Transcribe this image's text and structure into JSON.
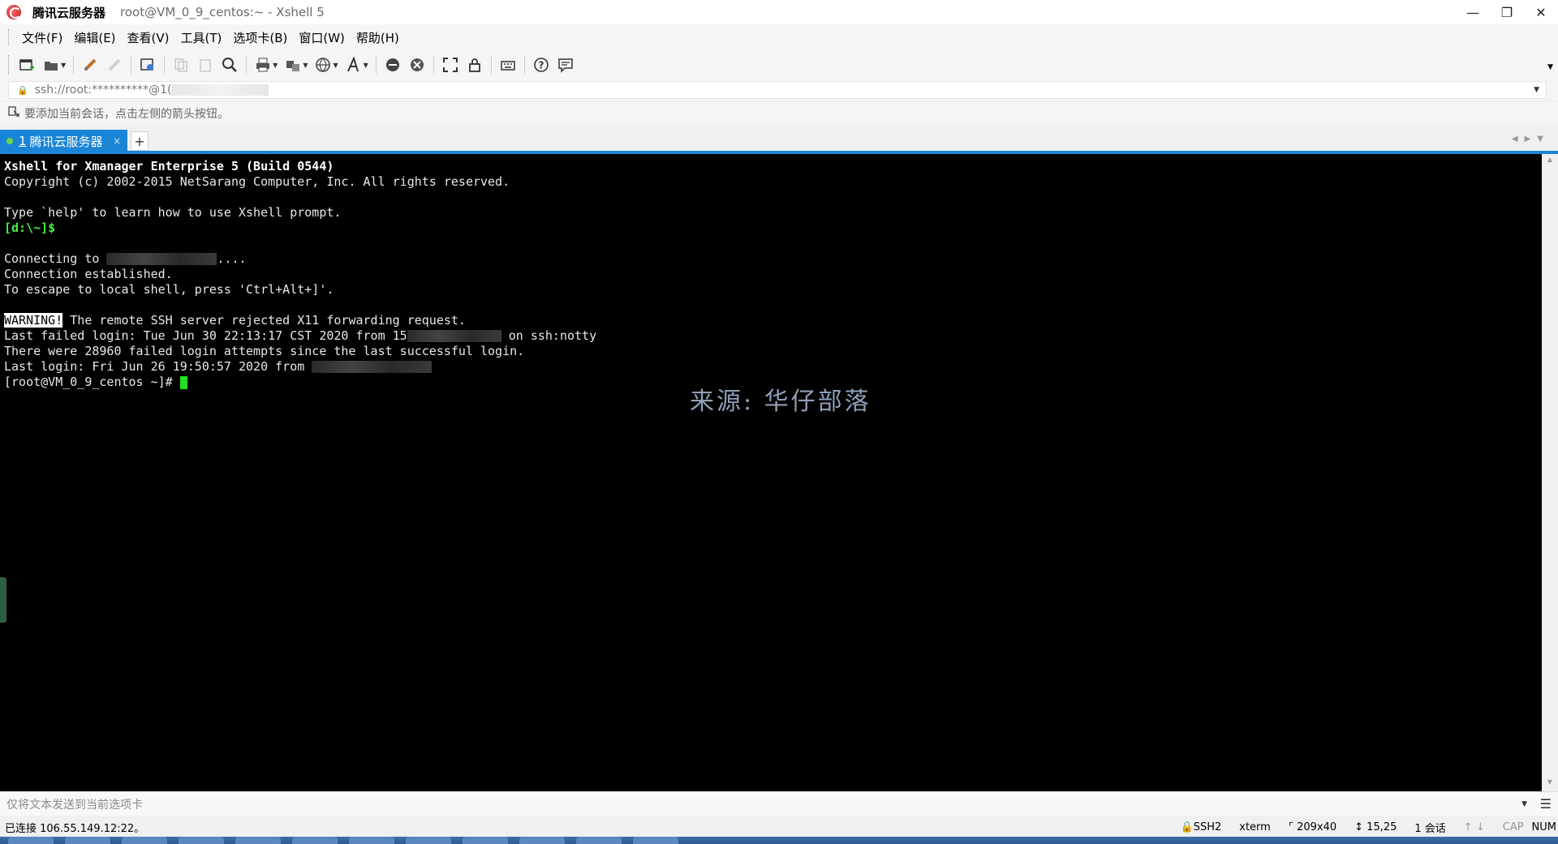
{
  "titlebar": {
    "session_name": "腾讯云服务器",
    "window_title": "root@VM_0_9_centos:~ - Xshell 5",
    "minimize": "—",
    "restore": "❐",
    "close": "✕"
  },
  "menu": {
    "items": [
      "文件(F)",
      "编辑(E)",
      "查看(V)",
      "工具(T)",
      "选项卡(B)",
      "窗口(W)",
      "帮助(H)"
    ]
  },
  "toolbar": {
    "icons": [
      "new-session-icon",
      "open-folder-icon",
      "connect-icon",
      "disconnect-icon",
      "session-properties-icon",
      "copy-icon",
      "paste-icon",
      "find-icon",
      "print-icon",
      "transfer-icon",
      "globe-icon",
      "font-icon",
      "xftp-icon",
      "xmanager-icon",
      "fullscreen-icon",
      "lock-icon",
      "keyboard-icon",
      "help-icon",
      "chat-icon"
    ]
  },
  "address": {
    "text": "ssh://root:**********@1("
  },
  "hint": {
    "text": "要添加当前会话，点击左侧的箭头按钮。"
  },
  "tabs": {
    "active": {
      "number": "1",
      "label": "腾讯云服务器",
      "close": "×"
    },
    "add": "+"
  },
  "terminal": {
    "line1": "Xshell for Xmanager Enterprise 5 (Build 0544)",
    "line2": "Copyright (c) 2002-2015 NetSarang Computer, Inc. All rights reserved.",
    "line4": "Type `help' to learn how to use Xshell prompt.",
    "line5": "[d:\\~]$",
    "line7_prefix": "Connecting to ",
    "line7_suffix": "....",
    "line8": "Connection established.",
    "line9": "To escape to local shell, press 'Ctrl+Alt+]'.",
    "warn_tag": "WARNING!",
    "warn_text": " The remote SSH server rejected X11 forwarding request.",
    "line12_prefix": "Last failed login: Tue Jun 30 22:13:17 CST 2020 from 15",
    "line12_suffix": " on ssh:notty",
    "line13": "There were 28960 failed login attempts since the last successful login.",
    "line14_prefix": "Last login: Fri Jun 26 19:50:57 2020 from ",
    "prompt": "[root@VM_0_9_centos ~]# ",
    "watermark": "来源: 华仔部落"
  },
  "compose": {
    "placeholder": "仅将文本发送到当前选项卡"
  },
  "status": {
    "connected": "已连接 106.55.149.12:22。",
    "protocol": "SSH2",
    "term": "xterm",
    "size": "209x40",
    "cursor_pos": "15,25",
    "sessions": "1 会话",
    "cap": "CAP",
    "num": "NUM"
  }
}
